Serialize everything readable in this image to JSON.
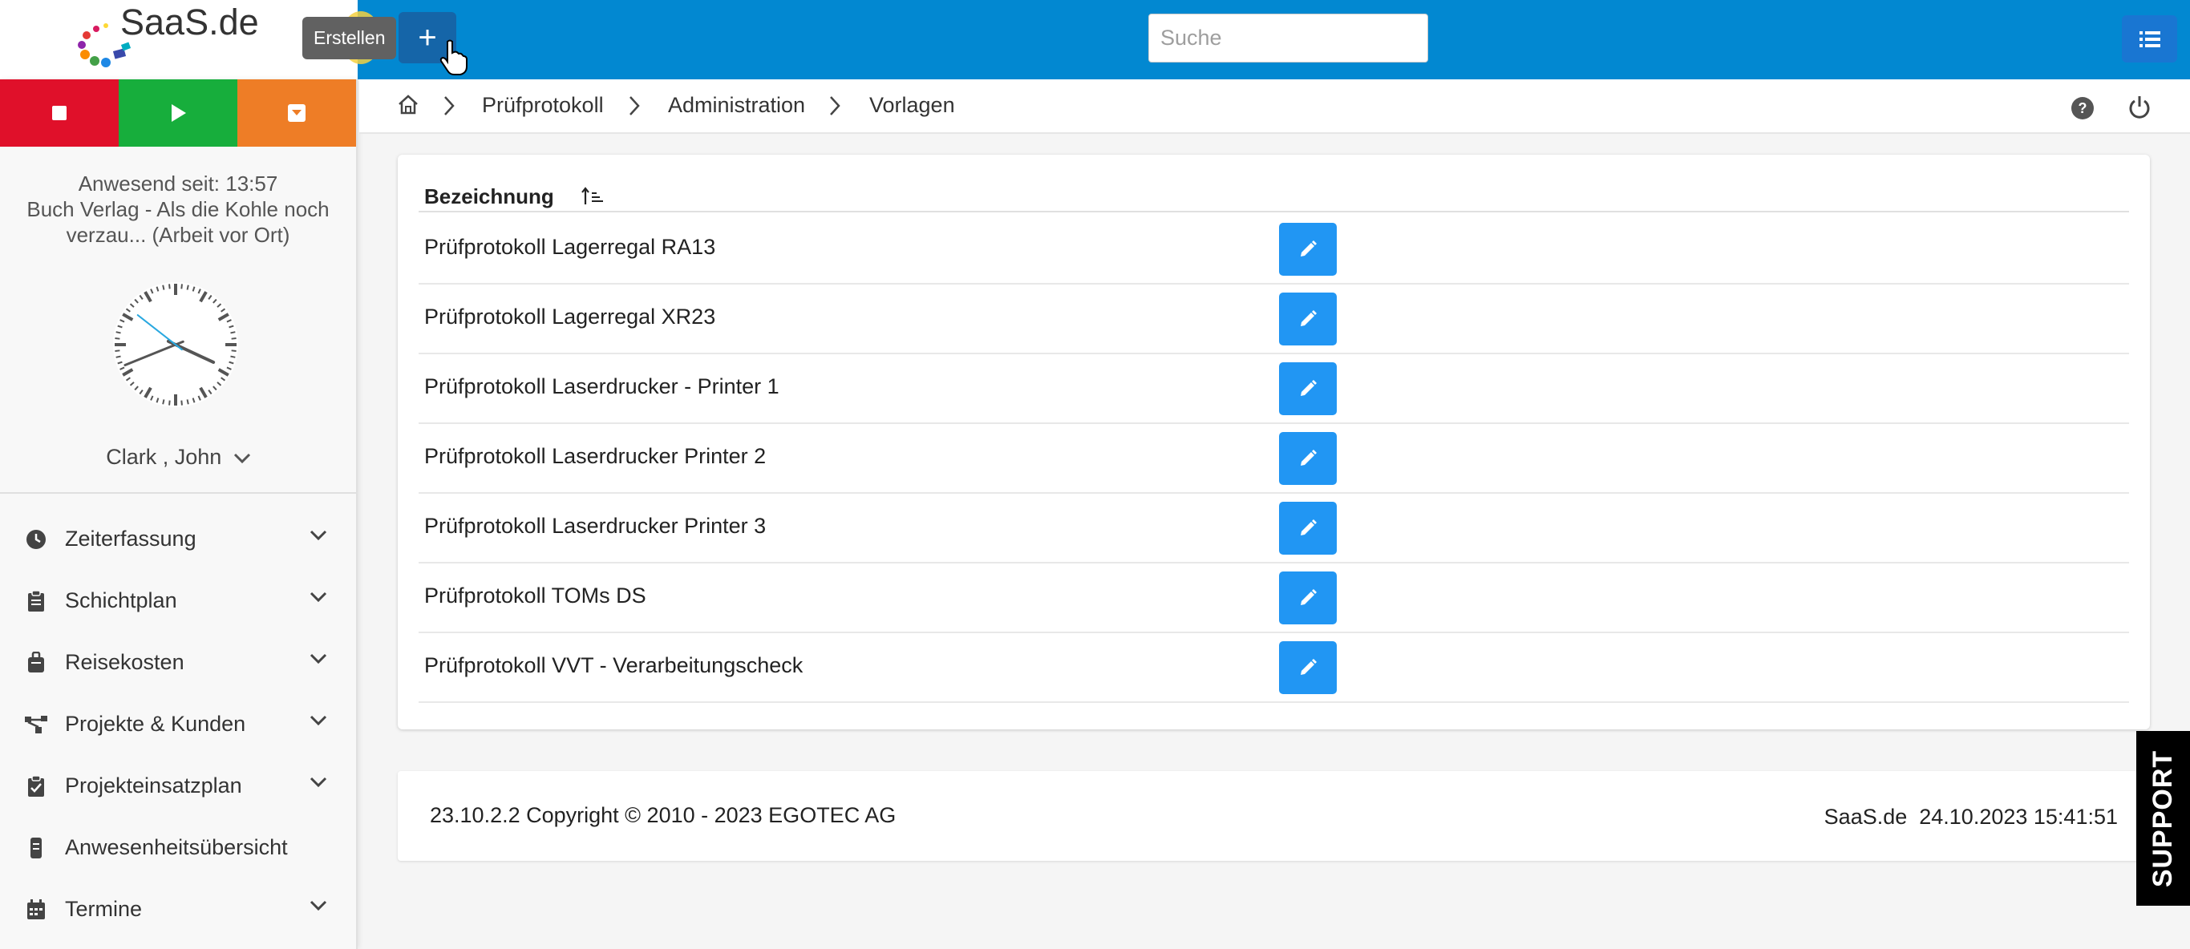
{
  "brand": {
    "logo_text": "SaaS.de"
  },
  "header": {
    "create_tooltip": "Erstellen",
    "create_symbol": "+",
    "search_placeholder": "Suche"
  },
  "sidebar": {
    "presence_line1": "Anwesend seit: 13:57",
    "presence_line2": "Buch Verlag - Als die Kohle noch verzau... (Arbeit vor Ort)",
    "user_name": "Clark , John",
    "nav": [
      {
        "label": "Zeiterfassung",
        "icon": "clock-icon",
        "expandable": true
      },
      {
        "label": "Schichtplan",
        "icon": "clipboard-icon",
        "expandable": true
      },
      {
        "label": "Reisekosten",
        "icon": "suitcase-icon",
        "expandable": true
      },
      {
        "label": "Projekte & Kunden",
        "icon": "project-tree-icon",
        "expandable": true
      },
      {
        "label": "Projekteinsatzplan",
        "icon": "clipboard-check-icon",
        "expandable": true
      },
      {
        "label": "Anwesenheitsübersicht",
        "icon": "badge-icon",
        "expandable": false
      },
      {
        "label": "Termine",
        "icon": "calendar-icon",
        "expandable": true
      }
    ]
  },
  "breadcrumb": [
    "Prüfprotokoll",
    "Administration",
    "Vorlagen"
  ],
  "table": {
    "column_header": "Bezeichnung",
    "rows": [
      "Prüfprotokoll Lagerregal RA13",
      "Prüfprotokoll Lagerregal XR23",
      "Prüfprotokoll Laserdrucker - Printer 1",
      "Prüfprotokoll Laserdrucker Printer 2",
      "Prüfprotokoll Laserdrucker Printer 3",
      "Prüfprotokoll TOMs DS",
      "Prüfprotokoll VVT - Verarbeitungscheck"
    ]
  },
  "footer": {
    "left": "23.10.2.2 Copyright © 2010 - 2023 EGOTEC AG",
    "right": "SaaS.de  24.10.2023 15:41:51"
  },
  "support_label": "SUPPORT",
  "colors": {
    "header_blue": "#0288d1",
    "stop_red": "#e0102a",
    "play_green": "#17ae3c",
    "pause_orange": "#ee7d26",
    "edit_blue": "#2196f3"
  }
}
